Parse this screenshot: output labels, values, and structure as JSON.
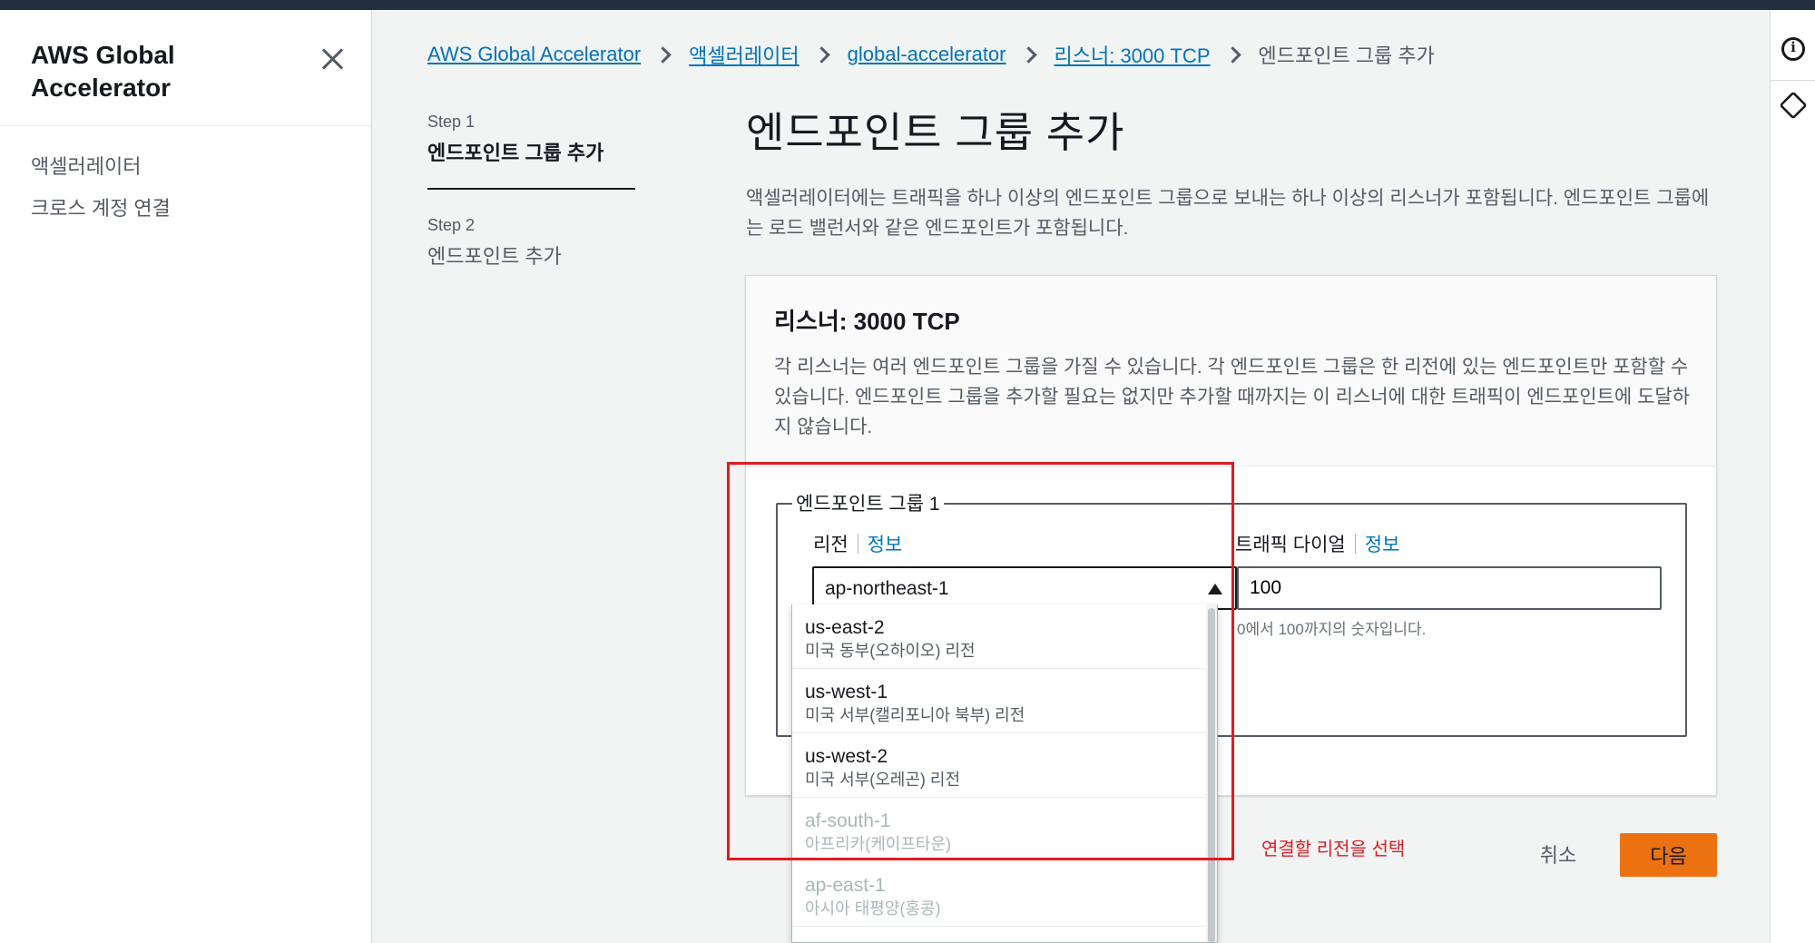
{
  "nav": {
    "title": "AWS Global Accelerator",
    "items": [
      {
        "label": "액셀러레이터"
      },
      {
        "label": "크로스 계정 연결"
      }
    ]
  },
  "breadcrumb": [
    {
      "label": "AWS Global Accelerator"
    },
    {
      "label": "액셀러레이터"
    },
    {
      "label": "global-accelerator"
    },
    {
      "label": "리스너: 3000 TCP"
    },
    {
      "label": "엔드포인트 그룹 추가"
    }
  ],
  "steps": [
    {
      "number": "Step 1",
      "name": "엔드포인트 그룹 추가"
    },
    {
      "number": "Step 2",
      "name": "엔드포인트 추가"
    }
  ],
  "page": {
    "title": "엔드포인트 그룹 추가",
    "description": "액셀러레이터에는 트래픽을 하나 이상의 엔드포인트 그룹으로 보내는 하나 이상의 리스너가 포함됩니다. 엔드포인트 그룹에는 로드 밸런서와 같은 엔드포인트가 포함됩니다."
  },
  "listener": {
    "title": "리스너: 3000 TCP",
    "description": "각 리스너는 여러 엔드포인트 그룹을 가질 수 있습니다. 각 엔드포인트 그룹은 한 리전에 있는 엔드포인트만 포함할 수 있습니다. 엔드포인트 그룹을 추가할 필요는 없지만 추가할 때까지는 이 리스너에 대한 트래픽이 엔드포인트에 도달하지 않습니다."
  },
  "group": {
    "legend": "엔드포인트 그룹 1",
    "region_label": "리전",
    "region_info": "정보",
    "region_value": "ap-northeast-1",
    "dial_label": "트래픽 다이얼",
    "dial_info": "정보",
    "dial_value": "100",
    "dial_hint": "0에서 100까지의 숫자입니다."
  },
  "region_options": [
    {
      "name": "us-east-2",
      "desc": "미국 동부(오하이오) 리전",
      "disabled": false
    },
    {
      "name": "us-west-1",
      "desc": "미국 서부(캘리포니아 북부) 리전",
      "disabled": false
    },
    {
      "name": "us-west-2",
      "desc": "미국 서부(오레곤) 리전",
      "disabled": false
    },
    {
      "name": "af-south-1",
      "desc": "아프리카(케이프타운)",
      "disabled": true
    },
    {
      "name": "ap-east-1",
      "desc": "아시아 태평양(홍콩)",
      "disabled": true
    }
  ],
  "annotation": "연결할 리전을 선택",
  "buttons": {
    "cancel": "취소",
    "next": "다음"
  },
  "colors": {
    "accent": "#ec7211",
    "link": "#0073bb",
    "annotation": "#dd1c24"
  }
}
